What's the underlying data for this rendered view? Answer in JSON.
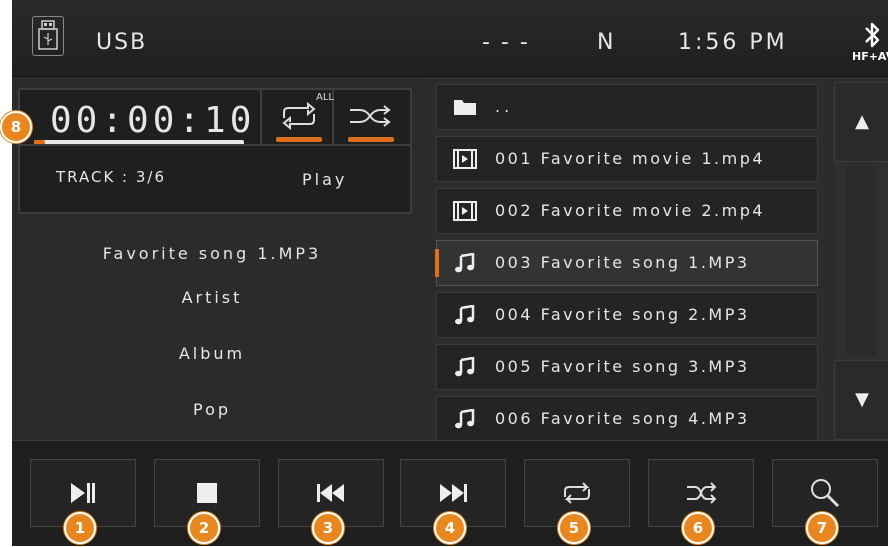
{
  "header": {
    "source_label": "USB",
    "dashes": "- - -",
    "band": "N",
    "clock": "1:56 PM",
    "bt_label": "HF+AV",
    "icons": [
      "usb-drive-icon",
      "bluetooth-icon"
    ]
  },
  "player": {
    "elapsed": "00:00:10",
    "progress_fraction": 0.05,
    "repeat_badge": "ALL",
    "track_info": "TRACK : 3/6",
    "state": "Play",
    "song_title": "Favorite song 1.MP3",
    "artist": "Artist",
    "album": "Album",
    "genre": "Pop",
    "accent_color": "#e0701b"
  },
  "filelist": {
    "parent": "..",
    "items": [
      {
        "label": "001 Favorite movie 1.mp4",
        "type": "video"
      },
      {
        "label": "002 Favorite movie 2.mp4",
        "type": "video"
      },
      {
        "label": "003 Favorite song 1.MP3",
        "type": "audio",
        "active": true
      },
      {
        "label": "004 Favorite song 2.MP3",
        "type": "audio"
      },
      {
        "label": "005 Favorite song 3.MP3",
        "type": "audio"
      },
      {
        "label": "006 Favorite song 4.MP3",
        "type": "audio"
      }
    ]
  },
  "controls": [
    {
      "icon": "play-pause-icon",
      "badge": "1"
    },
    {
      "icon": "stop-icon",
      "badge": "2"
    },
    {
      "icon": "previous-track-icon",
      "badge": "3"
    },
    {
      "icon": "next-track-icon",
      "badge": "4"
    },
    {
      "icon": "repeat-icon",
      "badge": "5"
    },
    {
      "icon": "shuffle-icon",
      "badge": "6"
    },
    {
      "icon": "search-icon",
      "badge": "7"
    }
  ],
  "callout_badge_8": "8",
  "scroll": {
    "up": "▲",
    "down": "▼"
  }
}
